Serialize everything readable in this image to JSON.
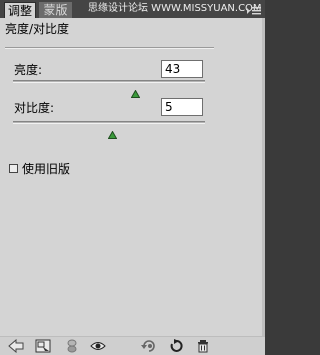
{
  "tabs": {
    "active_label": "调整",
    "inactive_label": "蒙版"
  },
  "watermark": "思缘设计论坛 WWW.MISSYUAN.COM",
  "panel": {
    "title": "亮度/对比度"
  },
  "brightness": {
    "label": "亮度:",
    "value": "43",
    "slider_fraction": 0.64
  },
  "contrast": {
    "label": "对比度:",
    "value": "5",
    "slider_fraction": 0.52
  },
  "legacy": {
    "label": "使用旧版",
    "checked": false
  },
  "colors": {
    "panel_bg": "#d4d4d4",
    "tab_bar_bg": "#454545",
    "slider_thumb": "#2e8b2e"
  },
  "toolbar_icons": [
    "back-arrow-icon",
    "clip-to-layer-icon",
    "visibility-toggle-icon",
    "view-previous-state-icon",
    "reset-icon",
    "delete-icon"
  ]
}
